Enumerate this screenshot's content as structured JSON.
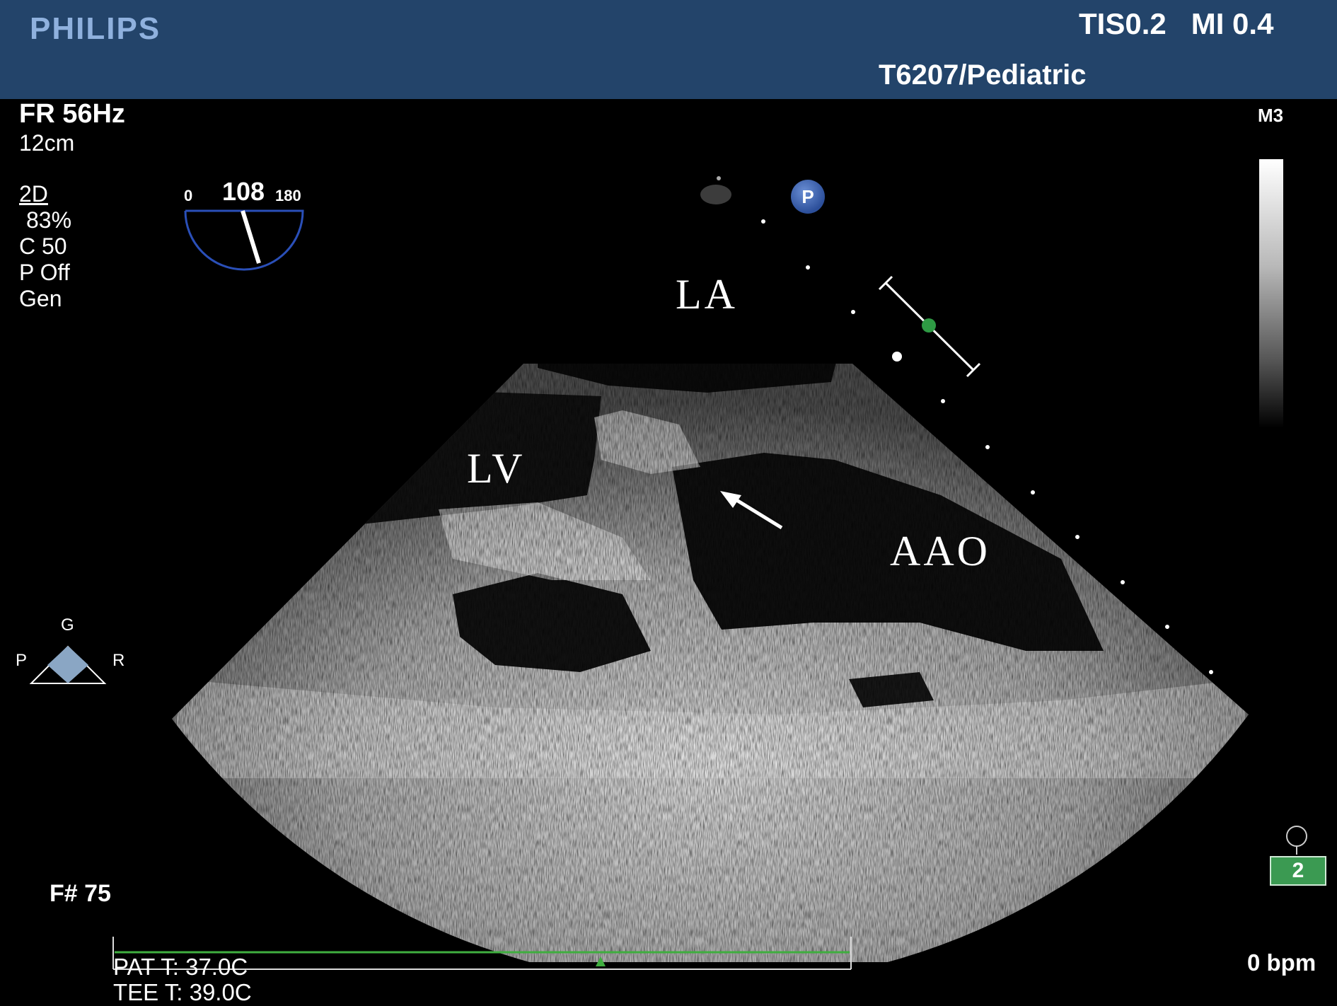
{
  "header": {
    "brand": "PHILIPS",
    "thermal_mechanical_index": "TIS0.2   MI 0.4",
    "probe_preset": "T6207/Pediatric"
  },
  "acquisition": {
    "frame_rate": "FR 56Hz",
    "depth": "12cm",
    "mode": "2D",
    "gain": "83%",
    "compression": "C 50",
    "persistence": "P Off",
    "resolution": "Gen"
  },
  "multiplane": {
    "min_label": "0",
    "angle": "108",
    "max_label": "180"
  },
  "grayscale_map": "M3",
  "probe_marker": "P",
  "orientation": {
    "top": "G",
    "left": "P",
    "right": "R"
  },
  "anatomy_labels": {
    "left_atrium": "LA",
    "left_ventricle": "LV",
    "ascending_aorta": "AAO"
  },
  "status": {
    "frame_number": "F# 75",
    "patient_temp": "PAT T: 37.0C",
    "tee_temp": "TEE T: 39.0C",
    "heart_rate": "0 bpm",
    "resp_number": "2"
  },
  "colors": {
    "header_bg": "#23446a",
    "brand": "#8fb1de",
    "ecg_trace": "#3fae3f",
    "resp_box": "#3b9a52"
  }
}
